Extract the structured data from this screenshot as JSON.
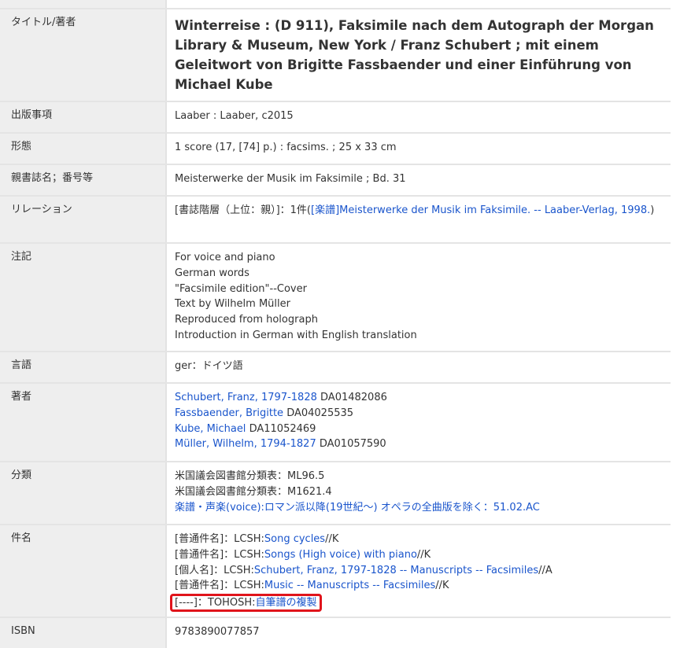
{
  "record": {
    "title": {
      "label": "タイトル/著者",
      "value": "Winterreise : (D 911), Faksimile nach dem Autograph der Morgan Library & Museum, New York / Franz Schubert ; mit einem Geleitwort von Brigitte Fassbaender und einer Einführung von Michael Kube"
    },
    "publication": {
      "label": "出版事項",
      "value": "Laaber : Laaber, c2015"
    },
    "physical": {
      "label": "形態",
      "value": "1 score (17, [74] p.) : facsims. ; 25 x 33 cm"
    },
    "series": {
      "label": "親書誌名；番号等",
      "value": "Meisterwerke der Musik im Faksimile ; Bd. 31"
    },
    "relation": {
      "label": "リレーション",
      "prefix": "[書誌階層（上位：親）]：1件(",
      "link": "[楽譜]Meisterwerke der Musik im Faksimile. -- Laaber-Verlag, 1998.",
      "suffix": ")"
    },
    "notes": {
      "label": "注記",
      "lines": [
        "For voice and piano",
        "German words",
        "\"Facsimile edition\"--Cover",
        "Text by Wilhelm Müller",
        "Reproduced from holograph",
        "Introduction in German with English translation"
      ]
    },
    "language": {
      "label": "言語",
      "value": "ger：ドイツ語"
    },
    "authors": {
      "label": "著者",
      "items": [
        {
          "name": "Schubert, Franz, 1797-1828",
          "id": "DA01482086"
        },
        {
          "name": "Fassbaender, Brigitte",
          "id": "DA04025535"
        },
        {
          "name": "Kube, Michael",
          "id": "DA11052469"
        },
        {
          "name": "Müller, Wilhelm, 1794-1827",
          "id": "DA01057590"
        }
      ]
    },
    "classification": {
      "label": "分類",
      "lines": [
        "米国議会図書館分類表：ML96.5",
        "米国議会図書館分類表：M1621.4"
      ],
      "link": "楽譜・声楽(voice):ロマン派以降(19世紀～) オペラの全曲版を除く：51.02.AC"
    },
    "subjects": {
      "label": "件名",
      "items": [
        {
          "prefix": "[普通件名]：LCSH:",
          "link": "Song cycles",
          "suffix": "//K"
        },
        {
          "prefix": "[普通件名]：LCSH:",
          "link": "Songs (High voice) with piano",
          "suffix": "//K"
        },
        {
          "prefix": "[個人名]：LCSH:",
          "link": "Schubert, Franz, 1797-1828 -- Manuscripts -- Facsimiles",
          "suffix": "//A"
        },
        {
          "prefix": "[普通件名]：LCSH:",
          "link": "Music -- Manuscripts -- Facsimiles",
          "suffix": "//K"
        },
        {
          "prefix": "[----]：TOHOSH:",
          "link": "自筆譜の複製",
          "suffix": ""
        }
      ]
    },
    "isbn": {
      "label": "ISBN",
      "value": "9783890077857"
    }
  },
  "colors": {
    "link": "#1a55cc",
    "highlight_border": "#e0141b",
    "label_bg": "#eeeeee"
  }
}
